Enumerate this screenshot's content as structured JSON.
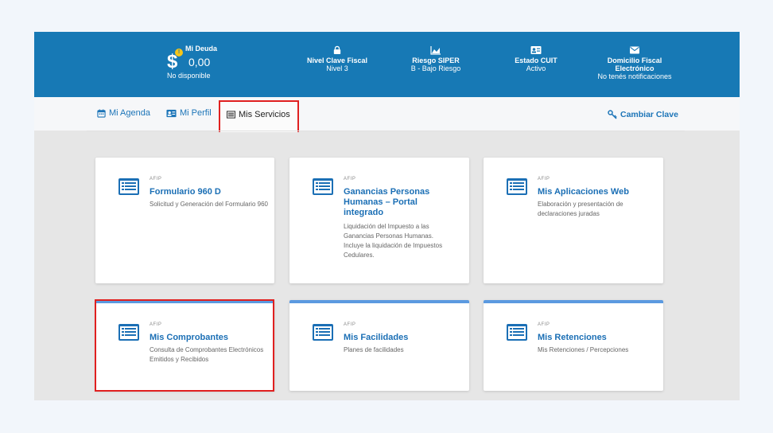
{
  "header": {
    "debt": {
      "label": "Mi Deuda",
      "amount": "0,00",
      "status": "No disponible",
      "badge": "!"
    },
    "items": [
      {
        "title": "Nivel Clave Fiscal",
        "sub": "Nivel 3",
        "icon": "lock-icon"
      },
      {
        "title": "Riesgo SIPER",
        "sub": "B - Bajo Riesgo",
        "icon": "chart-area-icon"
      },
      {
        "title": "Estado CUIT",
        "sub": "Activo",
        "icon": "id-card-icon"
      },
      {
        "title_line1": "Domicilio Fiscal",
        "title_line2": "Electrónico",
        "sub": "No tenés notificaciones",
        "icon": "envelope-icon"
      }
    ]
  },
  "nav": {
    "agenda": "Mi Agenda",
    "perfil": "Mi Perfil",
    "servicios": "Mis Servicios",
    "cambiar_clave": "Cambiar Clave"
  },
  "cards": [
    {
      "kicker": "AFIP",
      "title": "Formulario 960 D",
      "desc": "Solicitud y Generación del Formulario 960"
    },
    {
      "kicker": "AFIP",
      "title": "Ganancias Personas Humanas – Portal integrado",
      "desc": "Liquidación del Impuesto a las Ganancias Personas Humanas. Incluye la liquidación de Impuestos Cedulares."
    },
    {
      "kicker": "AFIP",
      "title": "Mis Aplicaciones Web",
      "desc": "Elaboración y presentación de declaraciones juradas"
    },
    {
      "kicker": "AFIP",
      "title": "Mis Comprobantes",
      "desc": "Consulta de Comprobantes Electrónicos Emitidos y Recibidos"
    },
    {
      "kicker": "AFIP",
      "title": "Mis Facilidades",
      "desc": "Planes de facilidades"
    },
    {
      "kicker": "AFIP",
      "title": "Mis Retenciones",
      "desc": "Mis Retenciones / Percepciones"
    }
  ],
  "colors": {
    "header": "#1779b5",
    "link": "#1b6fb5",
    "highlight": "#e02020",
    "card_accent": "#5b9ae0"
  }
}
